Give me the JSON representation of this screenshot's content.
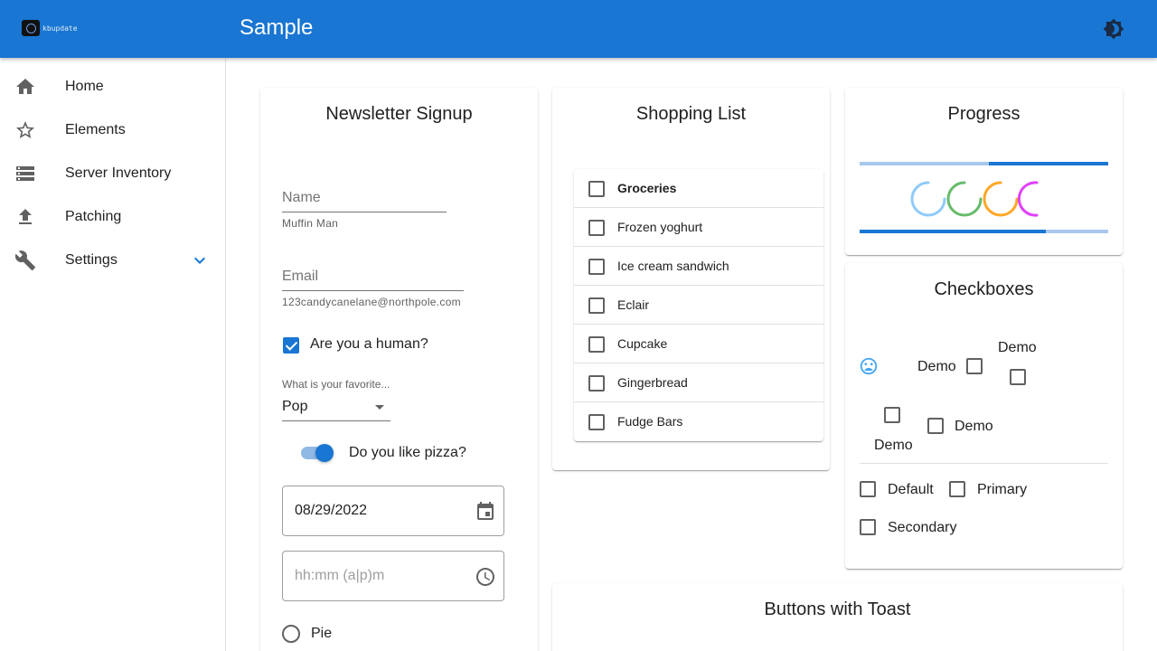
{
  "app": {
    "logo_text": "kbupdate",
    "title": "Sample",
    "theme_icon": "brightness-icon"
  },
  "nav": {
    "items": [
      {
        "label": "Home",
        "icon": "home-icon"
      },
      {
        "label": "Elements",
        "icon": "star-icon"
      },
      {
        "label": "Server Inventory",
        "icon": "server-icon"
      },
      {
        "label": "Patching",
        "icon": "upload-icon"
      },
      {
        "label": "Settings",
        "icon": "wrench-icon",
        "expandable": true
      }
    ]
  },
  "newsletter": {
    "title": "Newsletter Signup",
    "name_label": "Name",
    "name_helper": "Muffin Man",
    "email_label": "Email",
    "email_helper": "123candycanelane@northpole.com",
    "human_label": "Are you a human?",
    "human_checked": true,
    "favorite_label": "What is your favorite...",
    "favorite_value": "Pop",
    "pizza_label": "Do you like pizza?",
    "pizza_on": true,
    "date_value": "08/29/2022",
    "time_placeholder": "hh:mm (a|p)m",
    "radio_pie_label": "Pie"
  },
  "shopping": {
    "title": "Shopping List",
    "header": "Groceries",
    "items": [
      "Frozen yoghurt",
      "Ice cream sandwich",
      "Eclair",
      "Cupcake",
      "Gingerbread",
      "Fudge Bars"
    ]
  },
  "progress": {
    "title": "Progress",
    "top_bar_value": 0.52,
    "bottom_bar_value": 0.75,
    "spinner_colors": [
      "#90caf9",
      "#66bb6a",
      "#ffa726",
      "#e040fb"
    ],
    "bar_color": "#1976d2",
    "bar_track_color": "#a8c8ec"
  },
  "checkboxes": {
    "title": "Checkboxes",
    "demo_label": "Demo",
    "default_label": "Default",
    "primary_label": "Primary",
    "secondary_label": "Secondary",
    "status_icon": "sad-face-icon"
  },
  "buttons_toast": {
    "title": "Buttons with Toast"
  }
}
